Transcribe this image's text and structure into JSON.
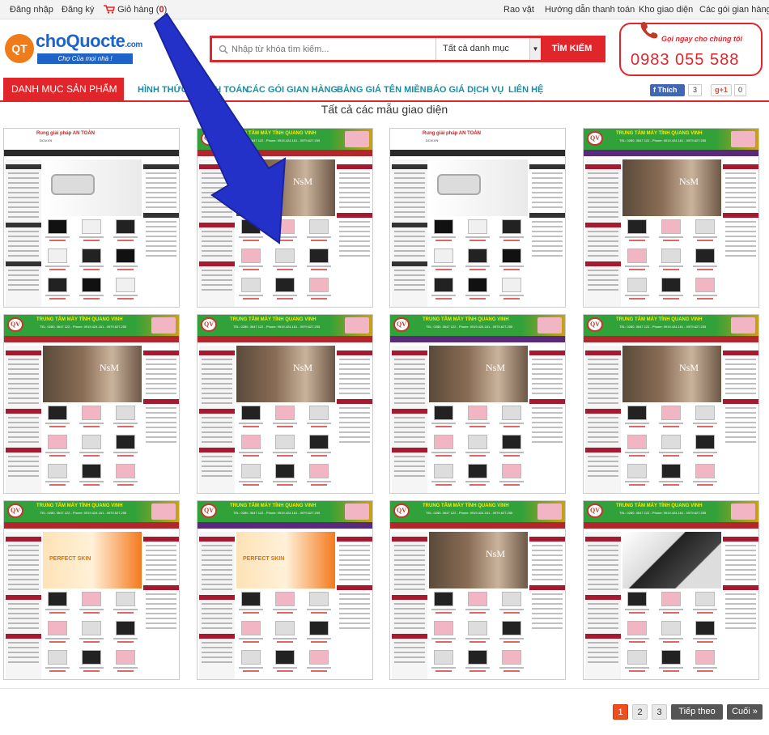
{
  "topbar": {
    "login": "Đăng nhập",
    "register": "Đăng ký",
    "cart_label": "Giỏ hàng (",
    "cart_count": "0",
    "cart_close": ")",
    "links": [
      "Rao vặt",
      "Hướng dẫn thanh toán",
      "Kho giao diện",
      "Các gói gian hàng"
    ]
  },
  "logo": {
    "badge": "QT",
    "name": "choQuocte",
    "domain": ".com",
    "slogan": "Chợ Của mọi nhà !"
  },
  "search": {
    "placeholder": "Nhập từ khóa tìm kiếm...",
    "category": "Tất cả danh mục",
    "button": "TÌM KIẾM"
  },
  "hotline": {
    "label": "Gọi ngay cho chúng tôi",
    "phone": "0983 055 588"
  },
  "nav": {
    "category_menu": "DANH MỤC SẢN PHẨM",
    "links": [
      "HÌNH THỨC THANH TOÁN",
      "CÁC GÓI GIAN HÀNG",
      "BẢNG GIÁ TÊN MIỀN",
      "BÁO GIÁ DỊCH VỤ",
      "LIÊN HỆ"
    ],
    "fb_like": "Thích",
    "fb_count": "3",
    "gplus": "g+1",
    "gplus_count": "0"
  },
  "page_title": "Tất cả các mẫu giao diện",
  "thumbnails": [
    {
      "kind": "security",
      "title": "Rung giải pháp AN TOÀN",
      "sub": "DCN.VN"
    },
    {
      "kind": "nsm",
      "title": "TRUNG TÂM MÁY TÍNH QUANG VINH",
      "sub": "TEL: 0280. 3647 122 - Phone: 0919.424.161 - 0979.627.255"
    },
    {
      "kind": "security",
      "title": "Rung giải pháp AN TOÀN",
      "sub": "DCN.VN"
    },
    {
      "kind": "nsm",
      "title": "TRUNG TÂM MÁY TÍNH QUANG VINH",
      "sub": "TEL: 0280. 3647 122 - Phone: 0919.424.161 - 0979.627.255"
    },
    {
      "kind": "nsm",
      "title": "TRUNG TÂM MÁY TÍNH QUANG VINH",
      "sub": "TEL: 0280. 3647 122 - Phone: 0919.424.161 - 0979.627.255"
    },
    {
      "kind": "nsm",
      "title": "TRUNG TÂM MÁY TÍNH QUANG VINH",
      "sub": "TEL: 0280. 3647 122 - Phone: 0919.424.161 - 0979.627.255"
    },
    {
      "kind": "nsm",
      "title": "TRUNG TÂM MÁY TÍNH QUANG VINH",
      "sub": "TEL: 0280. 3647 122 - Phone: 0919.424.161 - 0979.627.255"
    },
    {
      "kind": "nsm",
      "title": "TRUNG TÂM MÁY TÍNH QUANG VINH",
      "sub": "TEL: 0280. 3647 122 - Phone: 0919.424.161 - 0979.627.255"
    },
    {
      "kind": "skin",
      "title": "TRUNG TÂM MÁY TÍNH QUANG VINH",
      "sub": "TEL: 0280. 3647 122 - Phone: 0919.424.161 - 0979.627.255"
    },
    {
      "kind": "skin",
      "title": "TRUNG TÂM MÁY TÍNH QUANG VINH",
      "sub": "TEL: 0280. 3647 122 - Phone: 0919.424.161 - 0979.627.255"
    },
    {
      "kind": "nsm",
      "title": "TRUNG TÂM MÁY TÍNH QUANG VINH",
      "sub": "TEL: 0280. 3647 122 - Phone: 0919.424.161 - 0979.627.255"
    },
    {
      "kind": "vaio",
      "title": "TRUNG TÂM MÁY TÍNH QUANG VINH",
      "sub": "TEL: 0280. 3647 122 - Phone: 0919.424.161 - 0979.627.255"
    }
  ],
  "theme_colors": {
    "accent": "#e0262b",
    "header_green": "#31a13a",
    "header_gold": "#c9a217",
    "menu_red": "#b2272b",
    "menu_purple": "#5a2a7a",
    "sidebar_red": "#a6192e"
  },
  "pagination": {
    "pages": [
      "1",
      "2",
      "3"
    ],
    "current": "1",
    "next": "Tiếp theo »",
    "last": "Cuối »"
  },
  "icons": {
    "cart": "cart-icon",
    "search": "search-icon",
    "phone": "phone-icon",
    "arrow": "pointer-arrow-annotation"
  }
}
